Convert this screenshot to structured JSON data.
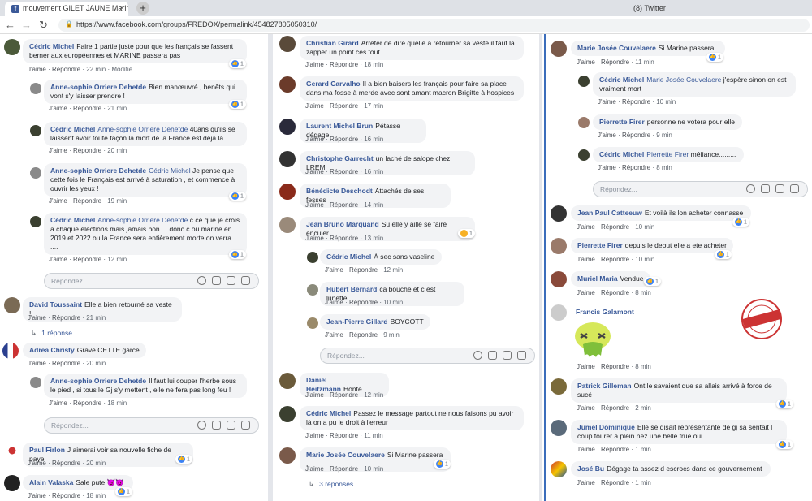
{
  "browser": {
    "tabs": [
      {
        "label": "mouvement GILET JAUNE Marin",
        "active": true
      },
      {
        "label": "",
        "active": false
      },
      {
        "label": "",
        "active": false
      },
      {
        "label": "",
        "active": false
      },
      {
        "label": "",
        "active": false
      },
      {
        "label": "(8) Twitter",
        "active": false
      }
    ],
    "url": "https://www.facebook.com/groups/FREDOX/permalink/454827805050310/"
  },
  "labels": {
    "like": "J'aime",
    "reply": "Répondre",
    "reply_placeholder": "Répondez..."
  },
  "col1": [
    {
      "name": "Cédric Michel",
      "text": "Faire 1 partie juste pour que les français se fassent berner aux européennes et MARINE passera pas",
      "time": "22 min",
      "extra": "Modifié",
      "react": "1"
    },
    {
      "name": "Anne-sophie Orriere Dehetde",
      "text": "Bien manœuvré , benêts qui vont s'y laisser prendre !",
      "time": "21 min",
      "react": "1"
    },
    {
      "name": "Cédric Michel",
      "tag": "Anne-sophie Orriere Dehetde",
      "text": "40ans qu'ils se laissent avoir toute façon la mort de la France est déjà là",
      "time": "20 min"
    },
    {
      "name": "Anne-sophie Orriere Dehetde",
      "tag": "Cédric Michel",
      "text": "Je pense que cette fois le Français est arrivé à saturation , et commence à ouvrir les yeux !",
      "time": "19 min",
      "react": "1"
    },
    {
      "name": "Cédric Michel",
      "tag": "Anne-sophie Orriere Dehetde",
      "text": "c ce que je crois a chaque élections mais jamais bon.....donc c ou marine en 2019 et 2022 ou la France sera entièrement morte on verra ....",
      "time": "12 min",
      "react": "1"
    },
    {
      "name": "David Toussaint",
      "text": "Elle a bien retourné sa veste !",
      "time": "21 min",
      "replies": "1 réponse"
    },
    {
      "name": "Adrea Christy",
      "text": "Grave CETTE garce",
      "time": "20 min"
    },
    {
      "name": "Anne-sophie Orriere Dehetde",
      "text": "Il faut lui couper l'herbe sous le pied , si tous le Gj s'y mettent , elle ne fera pas long feu !",
      "time": "18 min"
    },
    {
      "name": "Paul Firlon",
      "text": "J aimerai voir sa nouvelle fiche de paye",
      "time": "20 min",
      "react": "1"
    },
    {
      "name": "Alain Valaska",
      "text": "Sale pute 😈😈",
      "time": "18 min",
      "react": "1"
    }
  ],
  "col2": [
    {
      "name": "Christian Girard",
      "text": "Arrêter de dire quelle a retourner sa veste il faut la zapper un point ces tout",
      "time": "18 min"
    },
    {
      "name": "Gerard Carvalho",
      "text": "Il a bien baisers les français pour faire sa place dans ma fosse à merde avec sont amant macron Brigitte à hospices",
      "time": "17 min"
    },
    {
      "name": "Laurent Michel Brun",
      "text": "Pétasse dégage",
      "time": "16 min"
    },
    {
      "name": "Christophe Garrecht",
      "text": "un laché de salope chez LREM",
      "time": "16 min"
    },
    {
      "name": "Bénédicte Deschodt",
      "text": "Attachés de ses fesses",
      "time": "14 min"
    },
    {
      "name": "Jean Bruno Marquand",
      "text": "Su elle y aille se faire enculer",
      "time": "13 min",
      "react": "1"
    },
    {
      "name": "Cédric Michel",
      "text": "À sec sans vaseline",
      "time": "12 min"
    },
    {
      "name": "Hubert Bernard",
      "text": "ca bouche et c est lunette",
      "time": "10 min"
    },
    {
      "name": "Jean-Pierre Gillard",
      "text": "BOYCOTT",
      "time": "9 min"
    },
    {
      "name": "Daniel Heitzmann",
      "text": "Honte",
      "time": "12 min"
    },
    {
      "name": "Cédric Michel",
      "text": "Passez le message partout ne nous faisons pu avoir là on a pu le droit à l'erreur",
      "time": "11 min"
    },
    {
      "name": "Marie Josée Couvelaere",
      "text": "Si Marine passera .",
      "time": "10 min",
      "react": "1",
      "replies": "3 réponses"
    }
  ],
  "col3": [
    {
      "name": "Marie Josée Couvelaere",
      "text": "Si Marine passera .",
      "time": "11 min",
      "react": "1"
    },
    {
      "name": "Cédric Michel",
      "tag": "Marie Josée Couvelaere",
      "text": "j'espère sinon on est vraiment mort",
      "time": "10 min"
    },
    {
      "name": "Pierrette Firer",
      "text": "personne ne votera pour elle",
      "time": "9 min"
    },
    {
      "name": "Cédric Michel",
      "tag": "Pierrette Firer",
      "text": "méfiance.........",
      "time": "8 min"
    },
    {
      "name": "Jean Paul Catteeuw",
      "text": "Et voilà ils lon acheter connasse",
      "time": "10 min",
      "react": "1"
    },
    {
      "name": "Pierrette Firer",
      "text": "depuis le debut elle a ete acheter",
      "time": "10 min",
      "react": "1"
    },
    {
      "name": "Muriel Maria",
      "text": "Vendue",
      "time": "8 min",
      "react": "1"
    },
    {
      "name": "Francis Galamont",
      "text": "",
      "time": "8 min"
    },
    {
      "name": "Patrick Gilleman",
      "text": "Ont le savaient que sa allais arrivé à force de sucé",
      "time": "2 min",
      "react": "1"
    },
    {
      "name": "Jumel Dominique",
      "text": "Elle se disait représentante de gj sa sentait l coup fourer à plein nez une belle true oui",
      "time": "1 min",
      "react": "1"
    },
    {
      "name": "José Bu",
      "text": "Dégage ta assez d escrocs dans ce gouvernement",
      "time": "1 min"
    }
  ]
}
